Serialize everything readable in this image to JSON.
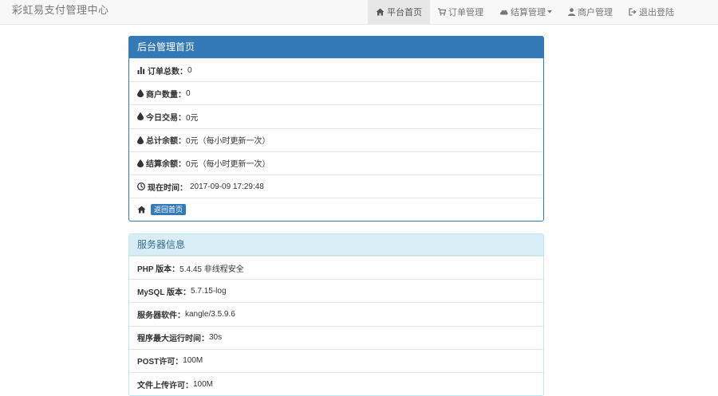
{
  "navbar": {
    "brand": "彩虹易支付管理中心",
    "items": [
      {
        "label": "平台首页",
        "icon": "home-icon",
        "active": true
      },
      {
        "label": "订单管理",
        "icon": "cart-icon",
        "active": false
      },
      {
        "label": "结算管理",
        "icon": "cloud-icon",
        "active": false
      },
      {
        "label": "商户管理",
        "icon": "user-icon",
        "active": false
      },
      {
        "label": "退出登陆",
        "icon": "logout-icon",
        "active": false
      }
    ]
  },
  "admin_panel": {
    "title": "后台管理首页",
    "rows": [
      {
        "label": "订单总数：",
        "value": "0",
        "icon": "bar-chart-icon"
      },
      {
        "label": "商户数量：",
        "value": "0",
        "icon": "drop-icon"
      },
      {
        "label": "今日交易：",
        "value": "0元",
        "icon": "drop-icon"
      },
      {
        "label": "总计余额：",
        "value": "0元（每小时更新一次）",
        "icon": "drop-icon"
      },
      {
        "label": "结算余额：",
        "value": "0元（每小时更新一次）",
        "icon": "drop-icon"
      },
      {
        "label": "现在时间：",
        "value": "2017-09-09 17:29:48",
        "icon": "clock-icon"
      }
    ],
    "back_label": "返回首页"
  },
  "server_panel": {
    "title": "服务器信息",
    "rows": [
      {
        "label": "PHP 版本：",
        "value": "5.4.45 非线程安全"
      },
      {
        "label": "MySQL 版本：",
        "value": "5.7.15-log"
      },
      {
        "label": "服务器软件：",
        "value": "kangle/3.5.9.6"
      },
      {
        "label": "程序最大运行时间：",
        "value": "30s"
      },
      {
        "label": "POST许可：",
        "value": "100M"
      },
      {
        "label": "文件上传许可：",
        "value": "100M"
      }
    ]
  },
  "colors": {
    "primary": "#337ab7",
    "info_bg": "#d9edf7",
    "info_text": "#31708f",
    "navbar_bg": "#f8f8f8"
  }
}
